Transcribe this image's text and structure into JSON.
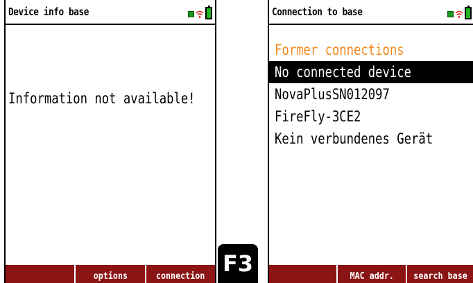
{
  "left_screen": {
    "title": "Device info base",
    "message": "Information not available!",
    "softkeys": [
      "",
      "options",
      "connection"
    ]
  },
  "hardware_key": {
    "label": "F3"
  },
  "right_screen": {
    "title": "Connection to base",
    "heading": "Former connections",
    "items": [
      {
        "label": "No connected device",
        "selected": true
      },
      {
        "label": "NovaPlusSN012097",
        "selected": false
      },
      {
        "label": "FireFly-3CE2",
        "selected": false
      },
      {
        "label": "Kein verbundenes Gerät",
        "selected": false
      }
    ],
    "softkeys": [
      "",
      "MAC addr.",
      "search base"
    ]
  },
  "status_icons": [
    "plug-icon",
    "wifi-icon",
    "battery-icon"
  ],
  "colors": {
    "softkey_bar": "#8c1414",
    "heading": "#f08a1c",
    "selection": "#000000",
    "battery": "#22b422"
  }
}
